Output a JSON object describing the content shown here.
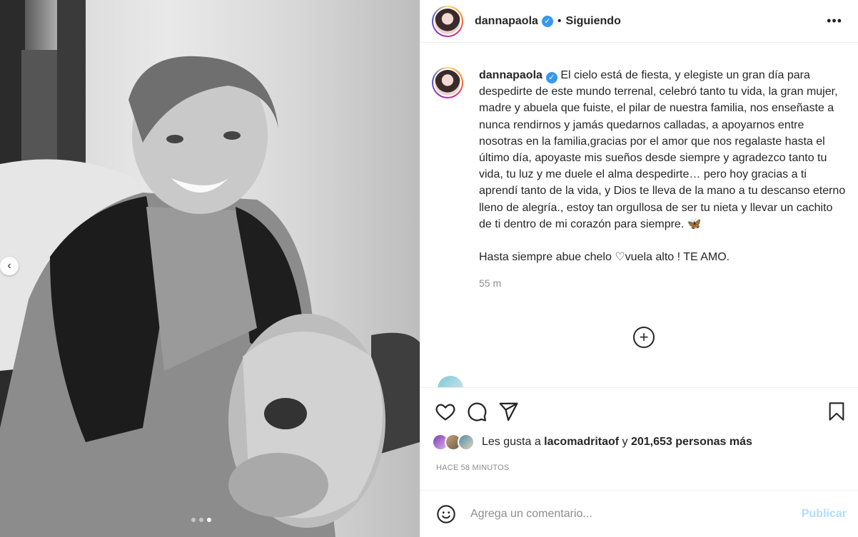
{
  "post": {
    "username": "dannapaola",
    "follow_status": "Siguiendo",
    "more_icon": "more-options-icon",
    "verified_icon": "verified-badge-icon"
  },
  "caption": {
    "username": "dannapaola",
    "text": "El cielo está de fiesta, y elegiste un gran día para despedirte de este mundo terrenal, celebró tanto tu vida, la gran mujer, madre y abuela que fuiste, el pilar de nuestra familia, nos enseñaste a nunca rendirnos y jamás quedarnos calladas, a apoyarnos entre nosotras en la familia,gracias por el amor que nos regalaste hasta el último día, apoyaste mis sueños desde siempre y agradezco tanto tu vida, tu luz y me duele el alma despedirte… pero hoy gracias a ti aprendí tanto de la vida, y Dios te lleva de la mano a tu descanso eterno lleno de alegría., estoy tan orgullosa de ser tu nieta y llevar un cachito de ti dentro de mi corazón para siempre. 🦋",
    "text2": "Hasta siempre abue chelo ♡vuela alto ! TE AMO.",
    "time": "55 m"
  },
  "likes": {
    "prefix": "Les gusta a ",
    "user": "lacomadritaof",
    "middle": " y ",
    "count": "201,653 personas más"
  },
  "posted_ago": "HACE 58 MINUTOS",
  "comment_input": {
    "placeholder": "Agrega un comentario...",
    "publish_label": "Publicar"
  },
  "carousel": {
    "total": 3,
    "active_index": 2
  },
  "colors": {
    "brand_blue": "#3897f0",
    "publish_disabled": "#b3dbff",
    "secondary_text": "#8e8e8e"
  }
}
